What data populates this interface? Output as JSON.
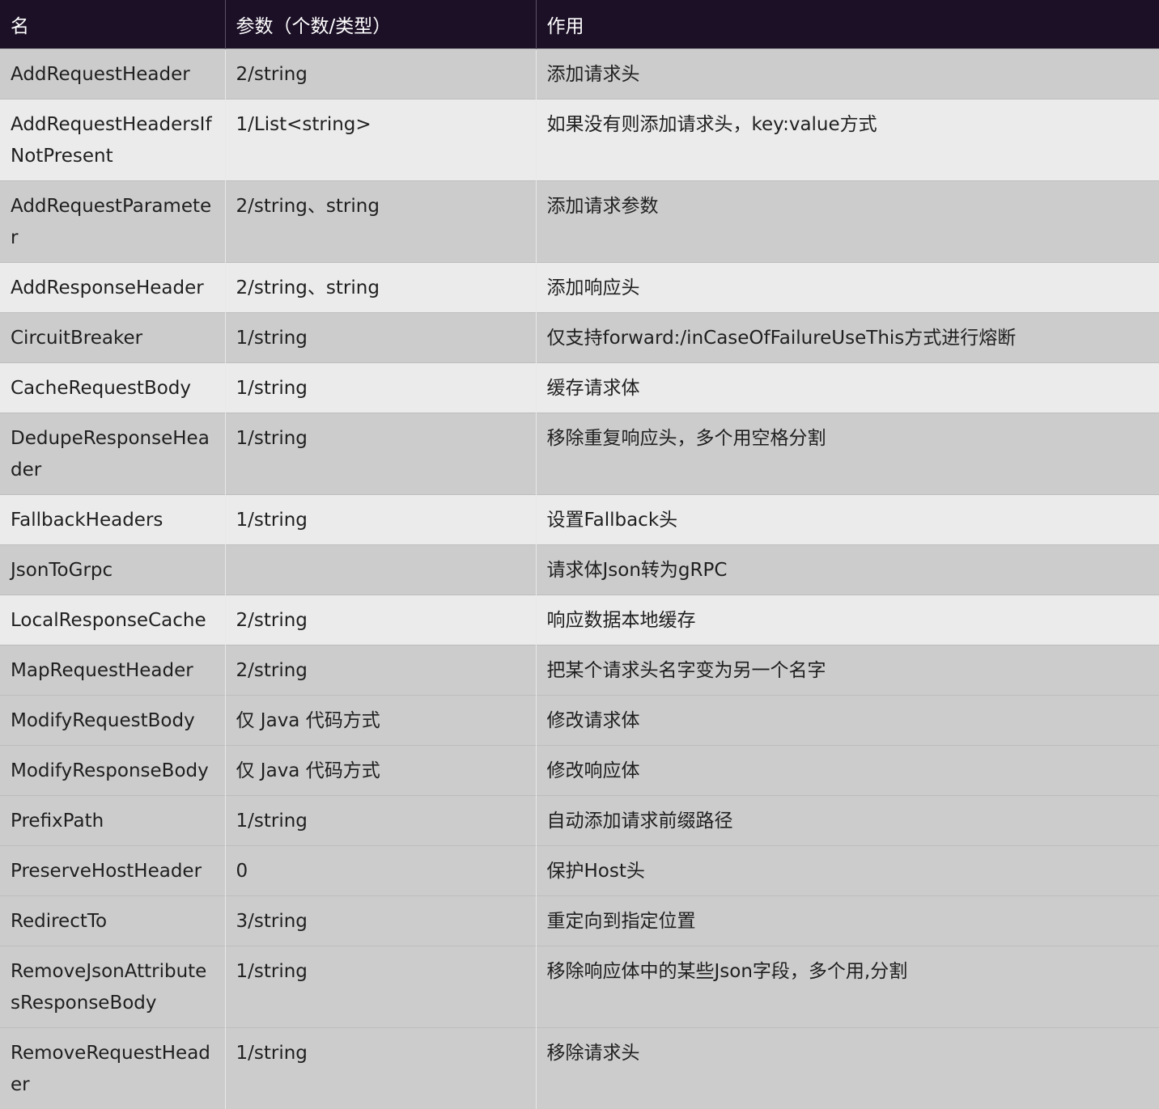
{
  "table": {
    "headers": [
      "名",
      "参数（个数/类型）",
      "作用"
    ],
    "rows": [
      [
        "AddRequestHeader",
        "2/string",
        "添加请求头"
      ],
      [
        "AddRequestHeadersIfNotPresent",
        "1/List<string>",
        "如果没有则添加请求头，key:value方式"
      ],
      [
        "AddRequestParameter",
        "2/string、string",
        "添加请求参数"
      ],
      [
        "AddResponseHeader",
        "2/string、string",
        "添加响应头"
      ],
      [
        "CircuitBreaker",
        "1/string",
        "仅支持forward:/inCaseOfFailureUseThis方式进行熔断"
      ],
      [
        "CacheRequestBody",
        "1/string",
        "缓存请求体"
      ],
      [
        "DedupeResponseHeader",
        "1/string",
        "移除重复响应头，多个用空格分割"
      ],
      [
        "FallbackHeaders",
        "1/string",
        "设置Fallback头"
      ],
      [
        "JsonToGrpc",
        "",
        "请求体Json转为gRPC"
      ],
      [
        "LocalResponseCache",
        "2/string",
        "响应数据本地缓存"
      ],
      [
        "MapRequestHeader",
        "2/string",
        "把某个请求头名字变为另一个名字"
      ],
      [
        "ModifyRequestBody",
        "仅 Java 代码方式",
        "修改请求体"
      ],
      [
        "ModifyResponseBody",
        "仅 Java 代码方式",
        "修改响应体"
      ],
      [
        "PrefixPath",
        "1/string",
        "自动添加请求前缀路径"
      ],
      [
        "PreserveHostHeader",
        "0",
        "保护Host头"
      ],
      [
        "RedirectTo",
        "3/string",
        "重定向到指定位置"
      ],
      [
        "RemoveJsonAttributesResponseBody",
        "1/string",
        "移除响应体中的某些Json字段，多个用,分割"
      ],
      [
        "RemoveRequestHeader",
        "1/string",
        "移除请求头"
      ]
    ]
  }
}
